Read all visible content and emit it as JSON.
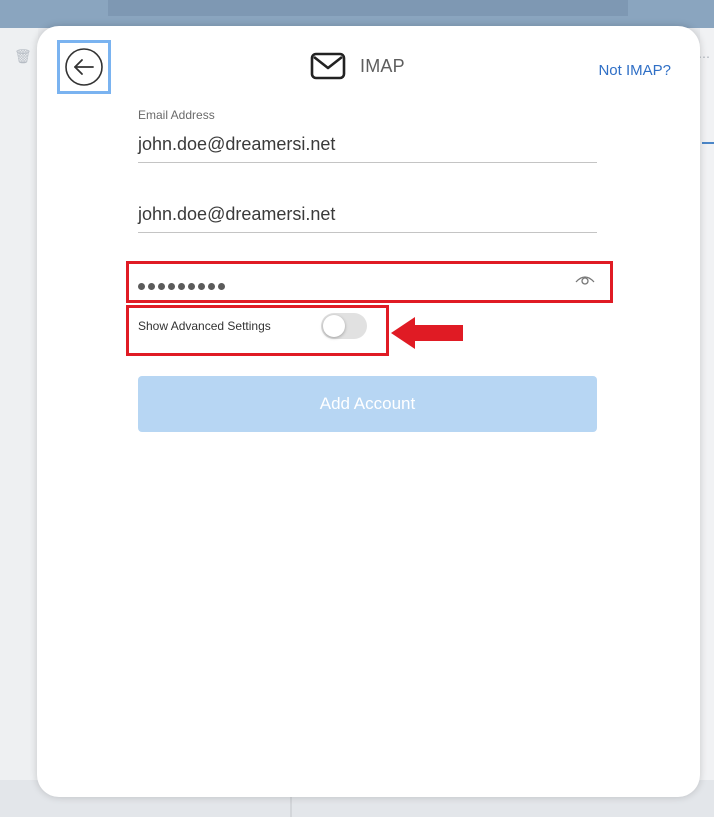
{
  "header": {
    "title": "IMAP",
    "not_imap_label": "Not IMAP?"
  },
  "form": {
    "email_label": "Email Address",
    "email_value": "john.doe@dreamersi.net",
    "username_value": "john.doe@dreamersi.net",
    "password_masked_length": 9,
    "advanced_label": "Show Advanced Settings",
    "advanced_enabled": false,
    "submit_label": "Add Account"
  },
  "icons": {
    "back": "back-arrow-icon",
    "mail": "mail-envelope-icon",
    "eye": "show-password-eye-icon",
    "annotation": "red-arrow-icon"
  },
  "colors": {
    "accent": "#2f6fc6",
    "annotation": "#e01b24",
    "button_disabled": "#b7d6f3"
  }
}
